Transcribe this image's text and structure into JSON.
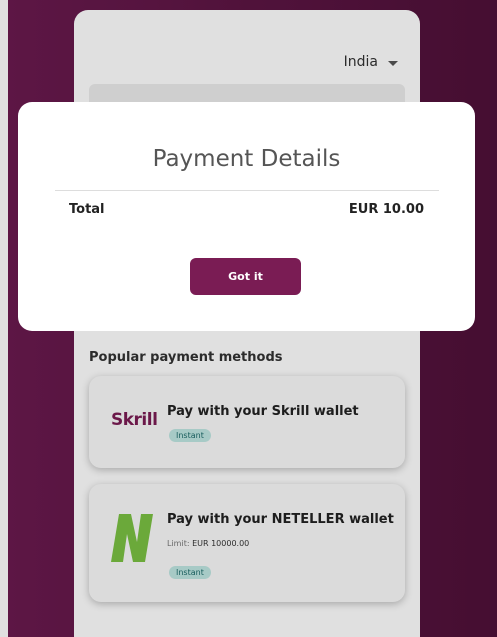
{
  "header": {
    "country": "India"
  },
  "payment_methods": {
    "section_title": "Popular payment methods",
    "items": [
      {
        "logo_text": "Skrill",
        "title": "Pay with your Skrill wallet",
        "badge": "Instant"
      },
      {
        "logo_text": "N",
        "title": "Pay with your NETELLER wallet",
        "limit_label": "Limit:",
        "limit_value": "EUR 10000.00",
        "badge": "Instant"
      }
    ]
  },
  "modal": {
    "title": "Payment Details",
    "total_label": "Total",
    "total_value": "EUR 10.00",
    "button_label": "Got it"
  },
  "colors": {
    "brand": "#7a1c54",
    "background": "#5c1543",
    "badge_bg": "#bfe6e2",
    "neteller_green": "#7ac143"
  }
}
